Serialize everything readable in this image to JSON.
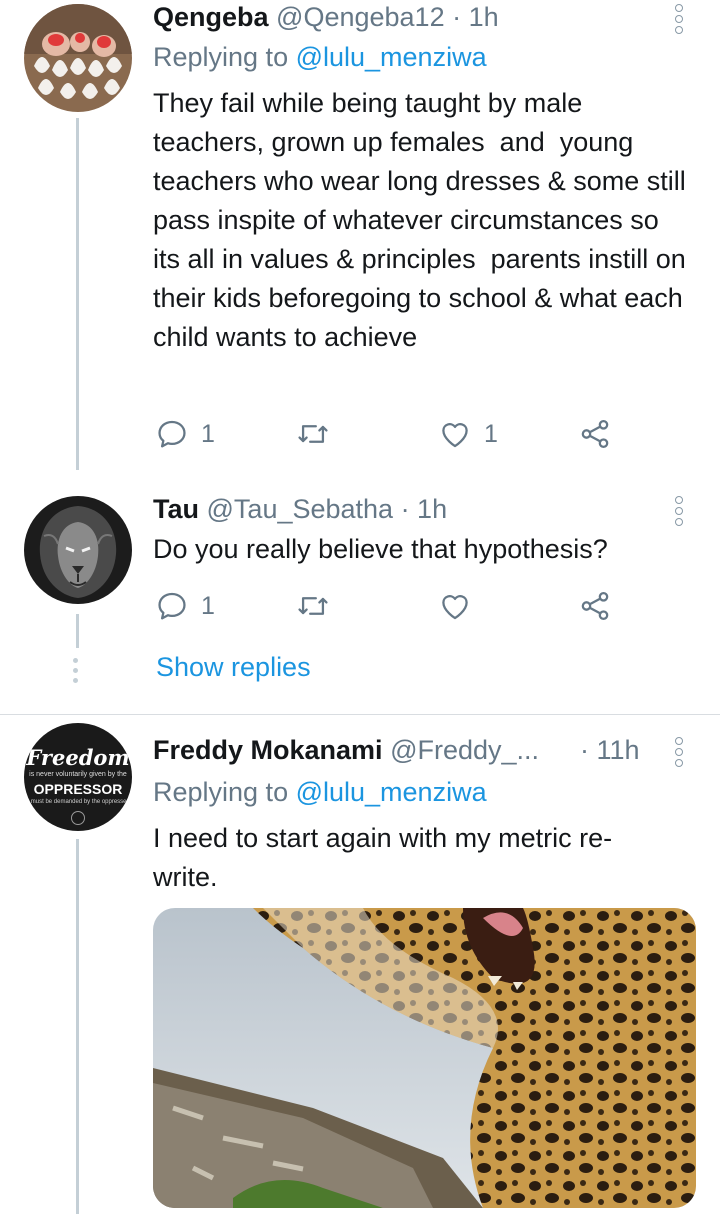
{
  "tweets": [
    {
      "name": "Qengeba",
      "handle": "@Qengeba12 · 1h",
      "replying_prefix": "Replying to ",
      "replying_mention": "@lulu_menziwa",
      "text": "They fail while being taught by male teachers, grown up females  and  young teachers who wear long dresses & some still pass inspite of whatever circumstances so its all in values & principles  parents instill on their kids beforegoing to school & what each child wants to achieve",
      "reply_count": "1",
      "retweet_count": "",
      "like_count": "1"
    },
    {
      "name": "Tau",
      "handle": "@Tau_Sebatha · 1h",
      "text": "Do you really believe that hypothesis?",
      "reply_count": "1",
      "retweet_count": "",
      "like_count": ""
    },
    {
      "name": "Freddy Mokanami",
      "handle": "@Freddy_...",
      "time": "· 11h",
      "replying_prefix": "Replying to ",
      "replying_mention": "@lulu_menziwa",
      "text": "I need to start again with my metric re-write."
    }
  ],
  "show_replies": "Show replies",
  "avatar3_logo": {
    "line1": "Freedom",
    "line2": "is never voluntarily given by the",
    "line3": "OPPRESSOR",
    "line4": "it must be demanded by the oppressed"
  },
  "icons": {
    "reply": "reply-icon",
    "retweet": "retweet-icon",
    "like": "heart-icon",
    "share": "share-icon",
    "menu": "more-vertical-icon"
  },
  "colors": {
    "accent": "#1b95e0",
    "secondary_text": "#657786",
    "thread_line": "#c4cfd6"
  }
}
